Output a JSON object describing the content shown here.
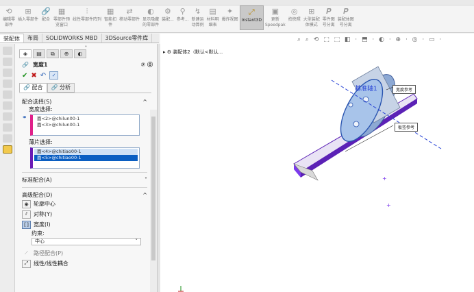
{
  "ribbon": {
    "items": [
      {
        "label": "编辑零\n部件",
        "icon": "edit-part-icon"
      },
      {
        "label": "插入零部件",
        "icon": "insert-component-icon"
      },
      {
        "label": "配合",
        "icon": "mate-icon"
      },
      {
        "label": "零部件预\n览窗口",
        "icon": "component-preview-icon"
      },
      {
        "label": "线性零部件阵列",
        "icon": "linear-pattern-icon"
      },
      {
        "label": "智能扣\n件",
        "icon": "smart-fastener-icon"
      },
      {
        "label": "移动零部件",
        "icon": "move-component-icon"
      },
      {
        "label": "显示隐藏\n的零部件",
        "icon": "show-hidden-icon"
      },
      {
        "label": "装配...",
        "icon": "assembly-feature-icon"
      },
      {
        "label": "参考...",
        "icon": "reference-geometry-icon"
      },
      {
        "label": "新建运\n动算例",
        "icon": "new-motion-study-icon"
      },
      {
        "label": "材料明\n细表",
        "icon": "bom-icon"
      },
      {
        "label": "爆炸视图",
        "icon": "exploded-view-icon"
      },
      {
        "label": "Instant3D",
        "icon": "instant3d-icon"
      },
      {
        "label": "更新\nSpeedpak",
        "icon": "speedpak-icon"
      },
      {
        "label": "拍快照",
        "icon": "snapshot-icon"
      },
      {
        "label": "大型装配\n体模式",
        "icon": "large-assembly-icon"
      },
      {
        "label": "零件图\n号分离",
        "icon": "part-number-icon"
      },
      {
        "label": "装配体图\n号分离",
        "icon": "assembly-number-icon"
      }
    ]
  },
  "tabs": [
    "装配体",
    "布局",
    "SOLIDWORKS MBD",
    "3DSource零件库"
  ],
  "pm": {
    "title": "宽度1",
    "help": "⑦ ⓪",
    "subtabs": [
      "配合",
      "分析"
    ],
    "mate_selections": {
      "header": "配合选择(S)",
      "width_label": "宽度选择:",
      "width_items": [
        "面<2>@chilun00-1",
        "面<3>@chilun00-1"
      ],
      "tab_label": "薄片选择:",
      "tab_items": [
        "面<4>@chitiao00-1",
        "面<5>@chitiao00-1"
      ]
    },
    "standard_header": "标准配合(A)",
    "advanced": {
      "header": "高级配合(D)",
      "options": [
        "轮廓中心",
        "对称(Y)",
        "宽度(I)"
      ],
      "constraint_label": "约束:",
      "constraint_value": "中心",
      "path_mate": "路径配合(P)",
      "linear_coupler": "线性/线性耦合"
    }
  },
  "graphics": {
    "tree_label": "装配体2（默认<默认...",
    "axis_label": "基准轴1",
    "tag_width": "宽度参考",
    "tag_plate": "板签参考"
  },
  "colors": {
    "accent_blue": "#0a5ec2",
    "selection_purple": "#6a1bb5",
    "selection_pink": "#e0218a",
    "wheel_blue": "#a8c4ea",
    "plate_purple": "#5b21b6"
  }
}
